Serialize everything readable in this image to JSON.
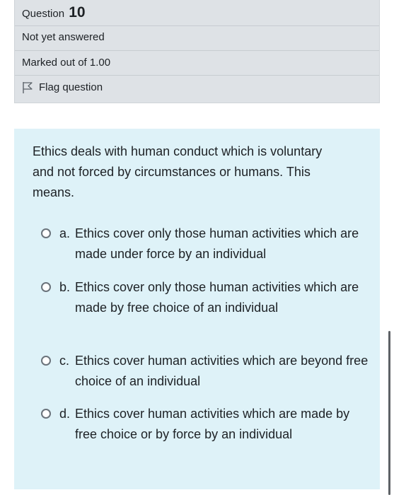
{
  "question_info": {
    "question_word": "Question",
    "question_number": "10",
    "status": "Not yet answered",
    "marks": "Marked out of 1.00",
    "flag_label": "Flag question"
  },
  "question": {
    "text": "Ethics deals with human conduct which is voluntary and not forced by circumstances or humans. This means.",
    "options": [
      {
        "letter": "a.",
        "text": "Ethics cover only those human activities which are made under force by an individual"
      },
      {
        "letter": "b.",
        "text": "Ethics cover only those human activities which are made by free choice of an individual"
      },
      {
        "letter": "c.",
        "text": "Ethics cover human activities which are beyond free choice of an individual"
      },
      {
        "letter": "d.",
        "text": "Ethics cover human activities which are made by free choice or by force by an individual"
      }
    ]
  },
  "colors": {
    "info_bg": "#dee2e6",
    "question_bg": "#def2f8",
    "text": "#1d2125"
  },
  "icons": {
    "flag": "flag-outline-icon",
    "radio": "radio-unselected-icon"
  }
}
